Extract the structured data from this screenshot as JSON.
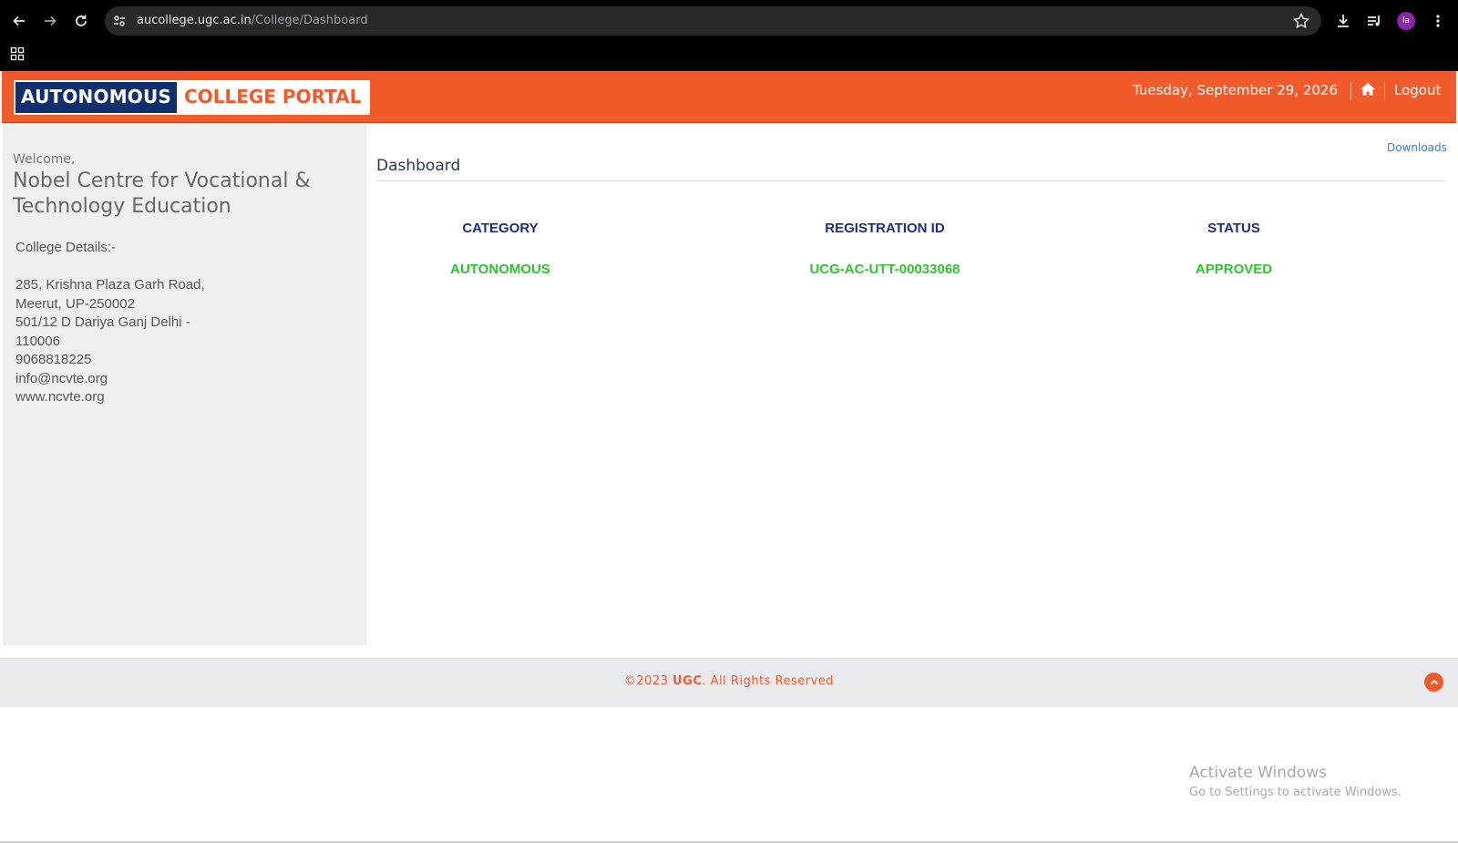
{
  "browser": {
    "url_host": "aucollege.ugc.ac.in",
    "url_path": "/College/Dashboard",
    "profile_initials": "la"
  },
  "header": {
    "logo_part1": "AUTONOMOUS",
    "logo_part2": "COLLEGE PORTAL",
    "date": "Tuesday, September 29, 2026",
    "logout": "Logout",
    "brand_color": "#f15a2b",
    "logo_navy": "#0f2f6e"
  },
  "sidebar": {
    "welcome": "Welcome,",
    "college_name": "Nobel Centre for Vocational & Technology Education",
    "details_label": "College Details:-",
    "details": [
      "285, Krishna Plaza Garh Road,",
      "Meerut, UP-250002",
      "501/12 D Dariya Ganj Delhi -",
      "110006",
      "9068818225",
      "info@ncvte.org",
      "www.ncvte.org"
    ]
  },
  "main": {
    "downloads_link": "Downloads",
    "title": "Dashboard",
    "table": {
      "headers": [
        "CATEGORY",
        "REGISTRATION  ID",
        "STATUS"
      ],
      "values": [
        "AUTONOMOUS",
        "UCG-AC-UTT-00033068",
        "APPROVED"
      ],
      "header_color": "#1a2e86",
      "value_color": "#2ec42e"
    }
  },
  "footer": {
    "copyright_prefix": "©2023 ",
    "brand": "UGC",
    "copyright_suffix": ". All Rights Reserved"
  },
  "watermark": {
    "title": "Activate Windows",
    "subtitle": "Go to Settings to activate Windows."
  }
}
